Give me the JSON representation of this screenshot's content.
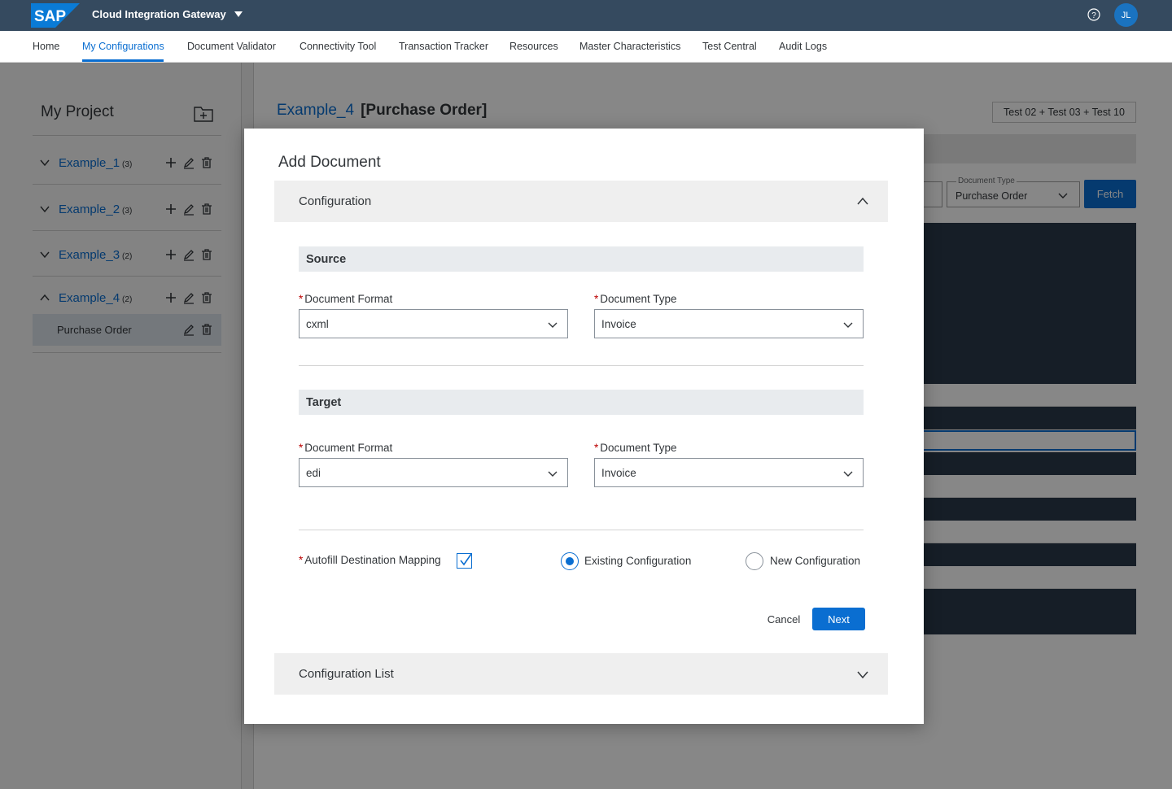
{
  "shell": {
    "logo_text": "SAP",
    "app_title": "Cloud Integration Gateway",
    "avatar_initials": "JL"
  },
  "nav": {
    "items": [
      "Home",
      "My Configurations",
      "Document Validator",
      "Connectivity Tool",
      "Transaction Tracker",
      "Resources",
      "Master Characteristics",
      "Test Central",
      "Audit Logs"
    ],
    "active": "My Configurations"
  },
  "sidebar": {
    "title": "My Project",
    "projects": [
      {
        "name": "Example_1",
        "count": "(3)",
        "expanded": false
      },
      {
        "name": "Example_2",
        "count": "(3)",
        "expanded": false
      },
      {
        "name": "Example_3",
        "count": "(2)",
        "expanded": false
      },
      {
        "name": "Example_4",
        "count": "(2)",
        "expanded": true
      }
    ],
    "documents": [
      "Purchase Order"
    ]
  },
  "main": {
    "project_name": "Example_4",
    "document_label": "[Purchase Order]",
    "test_badge": "Test 02 + Test 03 + Test 10",
    "doc_type_label": "Document Type",
    "doc_type_value": "Purchase Order",
    "fetch_label": "Fetch",
    "row_fragment": "e"
  },
  "dialog": {
    "title": "Add Document",
    "configuration_panel": "Configuration",
    "source": {
      "heading": "Source",
      "format_label": "Document Format",
      "format_value": "cxml",
      "type_label": "Document Type",
      "type_value": "Invoice"
    },
    "target": {
      "heading": "Target",
      "format_label": "Document Format",
      "format_value": "edi",
      "type_label": "Document Type",
      "type_value": "Invoice"
    },
    "autofill_label": "Autofill Destination Mapping",
    "autofill_checked": true,
    "existing_label": "Existing Configuration",
    "new_label": "New Configuration",
    "selected_option": "Existing Configuration",
    "cancel_label": "Cancel",
    "next_label": "Next",
    "config_list_panel": "Configuration List"
  },
  "colors": {
    "shell": "#354a5f",
    "accent": "#0a6ed1",
    "required": "#bb0000"
  }
}
